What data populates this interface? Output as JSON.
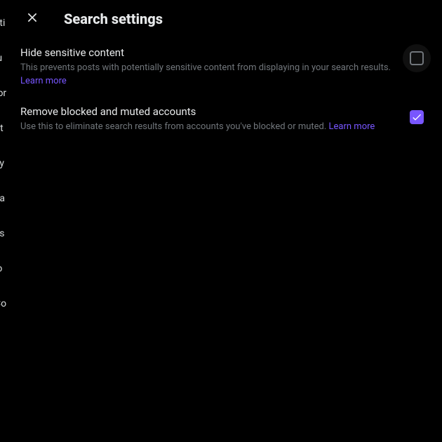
{
  "modal": {
    "title": "Search settings"
  },
  "settings": {
    "hide_sensitive": {
      "title": "Hide sensitive content",
      "description": "This prevents posts with potentially sensitive content from displaying in your search results.",
      "learn_more": "Learn more",
      "checked": false
    },
    "remove_blocked": {
      "title": "Remove blocked and muted accounts",
      "description": "Use this to eliminate search results from accounts you've blocked or muted.",
      "learn_more": "Learn more",
      "checked": true
    }
  },
  "background_nav": {
    "items": [
      "eti",
      "iu",
      "tor",
      "rit",
      "cy",
      "ca",
      "ss",
      "io",
      "Co"
    ]
  }
}
